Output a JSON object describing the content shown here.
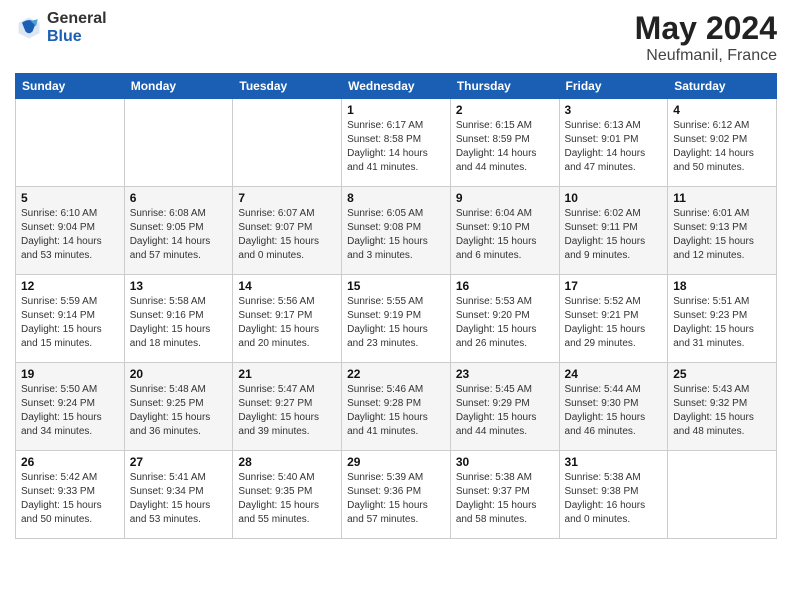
{
  "logo": {
    "general": "General",
    "blue": "Blue"
  },
  "title": {
    "month_year": "May 2024",
    "location": "Neufmanil, France"
  },
  "weekdays": [
    "Sunday",
    "Monday",
    "Tuesday",
    "Wednesday",
    "Thursday",
    "Friday",
    "Saturday"
  ],
  "weeks": [
    [
      {
        "day": "",
        "sunrise": "",
        "sunset": "",
        "daylight": ""
      },
      {
        "day": "",
        "sunrise": "",
        "sunset": "",
        "daylight": ""
      },
      {
        "day": "",
        "sunrise": "",
        "sunset": "",
        "daylight": ""
      },
      {
        "day": "1",
        "sunrise": "Sunrise: 6:17 AM",
        "sunset": "Sunset: 8:58 PM",
        "daylight": "Daylight: 14 hours and 41 minutes."
      },
      {
        "day": "2",
        "sunrise": "Sunrise: 6:15 AM",
        "sunset": "Sunset: 8:59 PM",
        "daylight": "Daylight: 14 hours and 44 minutes."
      },
      {
        "day": "3",
        "sunrise": "Sunrise: 6:13 AM",
        "sunset": "Sunset: 9:01 PM",
        "daylight": "Daylight: 14 hours and 47 minutes."
      },
      {
        "day": "4",
        "sunrise": "Sunrise: 6:12 AM",
        "sunset": "Sunset: 9:02 PM",
        "daylight": "Daylight: 14 hours and 50 minutes."
      }
    ],
    [
      {
        "day": "5",
        "sunrise": "Sunrise: 6:10 AM",
        "sunset": "Sunset: 9:04 PM",
        "daylight": "Daylight: 14 hours and 53 minutes."
      },
      {
        "day": "6",
        "sunrise": "Sunrise: 6:08 AM",
        "sunset": "Sunset: 9:05 PM",
        "daylight": "Daylight: 14 hours and 57 minutes."
      },
      {
        "day": "7",
        "sunrise": "Sunrise: 6:07 AM",
        "sunset": "Sunset: 9:07 PM",
        "daylight": "Daylight: 15 hours and 0 minutes."
      },
      {
        "day": "8",
        "sunrise": "Sunrise: 6:05 AM",
        "sunset": "Sunset: 9:08 PM",
        "daylight": "Daylight: 15 hours and 3 minutes."
      },
      {
        "day": "9",
        "sunrise": "Sunrise: 6:04 AM",
        "sunset": "Sunset: 9:10 PM",
        "daylight": "Daylight: 15 hours and 6 minutes."
      },
      {
        "day": "10",
        "sunrise": "Sunrise: 6:02 AM",
        "sunset": "Sunset: 9:11 PM",
        "daylight": "Daylight: 15 hours and 9 minutes."
      },
      {
        "day": "11",
        "sunrise": "Sunrise: 6:01 AM",
        "sunset": "Sunset: 9:13 PM",
        "daylight": "Daylight: 15 hours and 12 minutes."
      }
    ],
    [
      {
        "day": "12",
        "sunrise": "Sunrise: 5:59 AM",
        "sunset": "Sunset: 9:14 PM",
        "daylight": "Daylight: 15 hours and 15 minutes."
      },
      {
        "day": "13",
        "sunrise": "Sunrise: 5:58 AM",
        "sunset": "Sunset: 9:16 PM",
        "daylight": "Daylight: 15 hours and 18 minutes."
      },
      {
        "day": "14",
        "sunrise": "Sunrise: 5:56 AM",
        "sunset": "Sunset: 9:17 PM",
        "daylight": "Daylight: 15 hours and 20 minutes."
      },
      {
        "day": "15",
        "sunrise": "Sunrise: 5:55 AM",
        "sunset": "Sunset: 9:19 PM",
        "daylight": "Daylight: 15 hours and 23 minutes."
      },
      {
        "day": "16",
        "sunrise": "Sunrise: 5:53 AM",
        "sunset": "Sunset: 9:20 PM",
        "daylight": "Daylight: 15 hours and 26 minutes."
      },
      {
        "day": "17",
        "sunrise": "Sunrise: 5:52 AM",
        "sunset": "Sunset: 9:21 PM",
        "daylight": "Daylight: 15 hours and 29 minutes."
      },
      {
        "day": "18",
        "sunrise": "Sunrise: 5:51 AM",
        "sunset": "Sunset: 9:23 PM",
        "daylight": "Daylight: 15 hours and 31 minutes."
      }
    ],
    [
      {
        "day": "19",
        "sunrise": "Sunrise: 5:50 AM",
        "sunset": "Sunset: 9:24 PM",
        "daylight": "Daylight: 15 hours and 34 minutes."
      },
      {
        "day": "20",
        "sunrise": "Sunrise: 5:48 AM",
        "sunset": "Sunset: 9:25 PM",
        "daylight": "Daylight: 15 hours and 36 minutes."
      },
      {
        "day": "21",
        "sunrise": "Sunrise: 5:47 AM",
        "sunset": "Sunset: 9:27 PM",
        "daylight": "Daylight: 15 hours and 39 minutes."
      },
      {
        "day": "22",
        "sunrise": "Sunrise: 5:46 AM",
        "sunset": "Sunset: 9:28 PM",
        "daylight": "Daylight: 15 hours and 41 minutes."
      },
      {
        "day": "23",
        "sunrise": "Sunrise: 5:45 AM",
        "sunset": "Sunset: 9:29 PM",
        "daylight": "Daylight: 15 hours and 44 minutes."
      },
      {
        "day": "24",
        "sunrise": "Sunrise: 5:44 AM",
        "sunset": "Sunset: 9:30 PM",
        "daylight": "Daylight: 15 hours and 46 minutes."
      },
      {
        "day": "25",
        "sunrise": "Sunrise: 5:43 AM",
        "sunset": "Sunset: 9:32 PM",
        "daylight": "Daylight: 15 hours and 48 minutes."
      }
    ],
    [
      {
        "day": "26",
        "sunrise": "Sunrise: 5:42 AM",
        "sunset": "Sunset: 9:33 PM",
        "daylight": "Daylight: 15 hours and 50 minutes."
      },
      {
        "day": "27",
        "sunrise": "Sunrise: 5:41 AM",
        "sunset": "Sunset: 9:34 PM",
        "daylight": "Daylight: 15 hours and 53 minutes."
      },
      {
        "day": "28",
        "sunrise": "Sunrise: 5:40 AM",
        "sunset": "Sunset: 9:35 PM",
        "daylight": "Daylight: 15 hours and 55 minutes."
      },
      {
        "day": "29",
        "sunrise": "Sunrise: 5:39 AM",
        "sunset": "Sunset: 9:36 PM",
        "daylight": "Daylight: 15 hours and 57 minutes."
      },
      {
        "day": "30",
        "sunrise": "Sunrise: 5:38 AM",
        "sunset": "Sunset: 9:37 PM",
        "daylight": "Daylight: 15 hours and 58 minutes."
      },
      {
        "day": "31",
        "sunrise": "Sunrise: 5:38 AM",
        "sunset": "Sunset: 9:38 PM",
        "daylight": "Daylight: 16 hours and 0 minutes."
      },
      {
        "day": "",
        "sunrise": "",
        "sunset": "",
        "daylight": ""
      }
    ]
  ]
}
